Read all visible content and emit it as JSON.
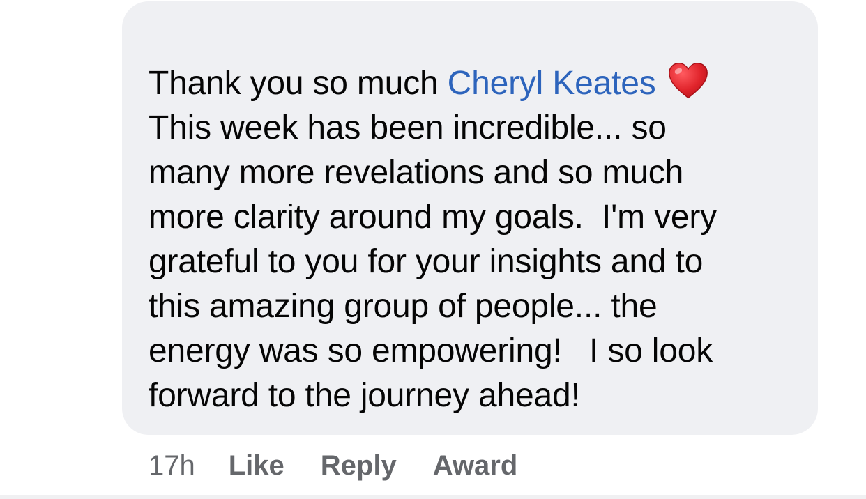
{
  "comment": {
    "prefix": "Thank you so much ",
    "mention": "Cheryl Keates",
    "reaction_emoji": "heart-icon",
    "lines": [
      "This week has been incredible... so",
      "many more revelations and so much",
      "more clarity around my goals.  I'm very",
      "grateful to you for your insights and to",
      "this amazing group of people... the",
      "energy was so empowering!   I so look",
      "forward to the journey ahead!"
    ]
  },
  "actions": {
    "timestamp": "17h",
    "like_label": "Like",
    "reply_label": "Reply",
    "award_label": "Award"
  },
  "colors": {
    "bubble_bg": "#eff0f3",
    "mention": "#2d64bc",
    "text": "#050505",
    "meta": "#65676b",
    "heart": "#e0242b"
  }
}
